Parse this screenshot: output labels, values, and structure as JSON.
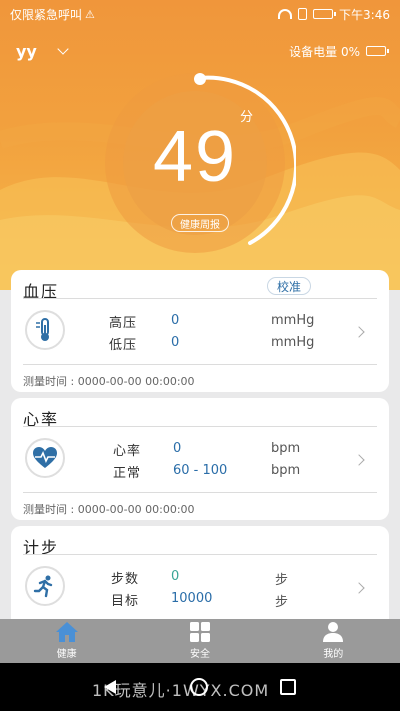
{
  "status_bar": {
    "left_text": "仅限紧急呼叫",
    "time": "下午3:46"
  },
  "header": {
    "user": "yy",
    "device_battery": "设备电量 0%"
  },
  "score": {
    "value": "49",
    "unit": "分",
    "report_button": "健康周报"
  },
  "blood_pressure": {
    "title": "血压",
    "calibrate_button": "校准",
    "rows": [
      {
        "label": "高压",
        "value": "0",
        "unit": "mmHg"
      },
      {
        "label": "低压",
        "value": "0",
        "unit": "mmHg"
      }
    ],
    "measure_time": "测量时间 : 0000-00-00 00:00:00"
  },
  "heart_rate": {
    "title": "心率",
    "rows": [
      {
        "label": "心率",
        "value": "0",
        "unit": "bpm"
      },
      {
        "label": "正常",
        "value": "60 - 100",
        "unit": "bpm"
      }
    ],
    "measure_time": "测量时间 : 0000-00-00 00:00:00"
  },
  "steps": {
    "title": "计步",
    "rows": [
      {
        "label": "步数",
        "value": "0",
        "unit": "步"
      },
      {
        "label": "目标",
        "value": "10000",
        "unit": "步"
      }
    ]
  },
  "tabs": [
    {
      "label": "健康",
      "icon": "home-icon",
      "active": true
    },
    {
      "label": "安全",
      "icon": "grid-icon",
      "active": false
    },
    {
      "label": "我的",
      "icon": "person-icon",
      "active": false
    }
  ],
  "watermark": "1K玩意儿·1WYX.COM",
  "colors": {
    "orange": "#f0963b",
    "value_blue": "#2a6da8",
    "value_green": "#3aa596",
    "tab_active": "#4a90d6"
  }
}
